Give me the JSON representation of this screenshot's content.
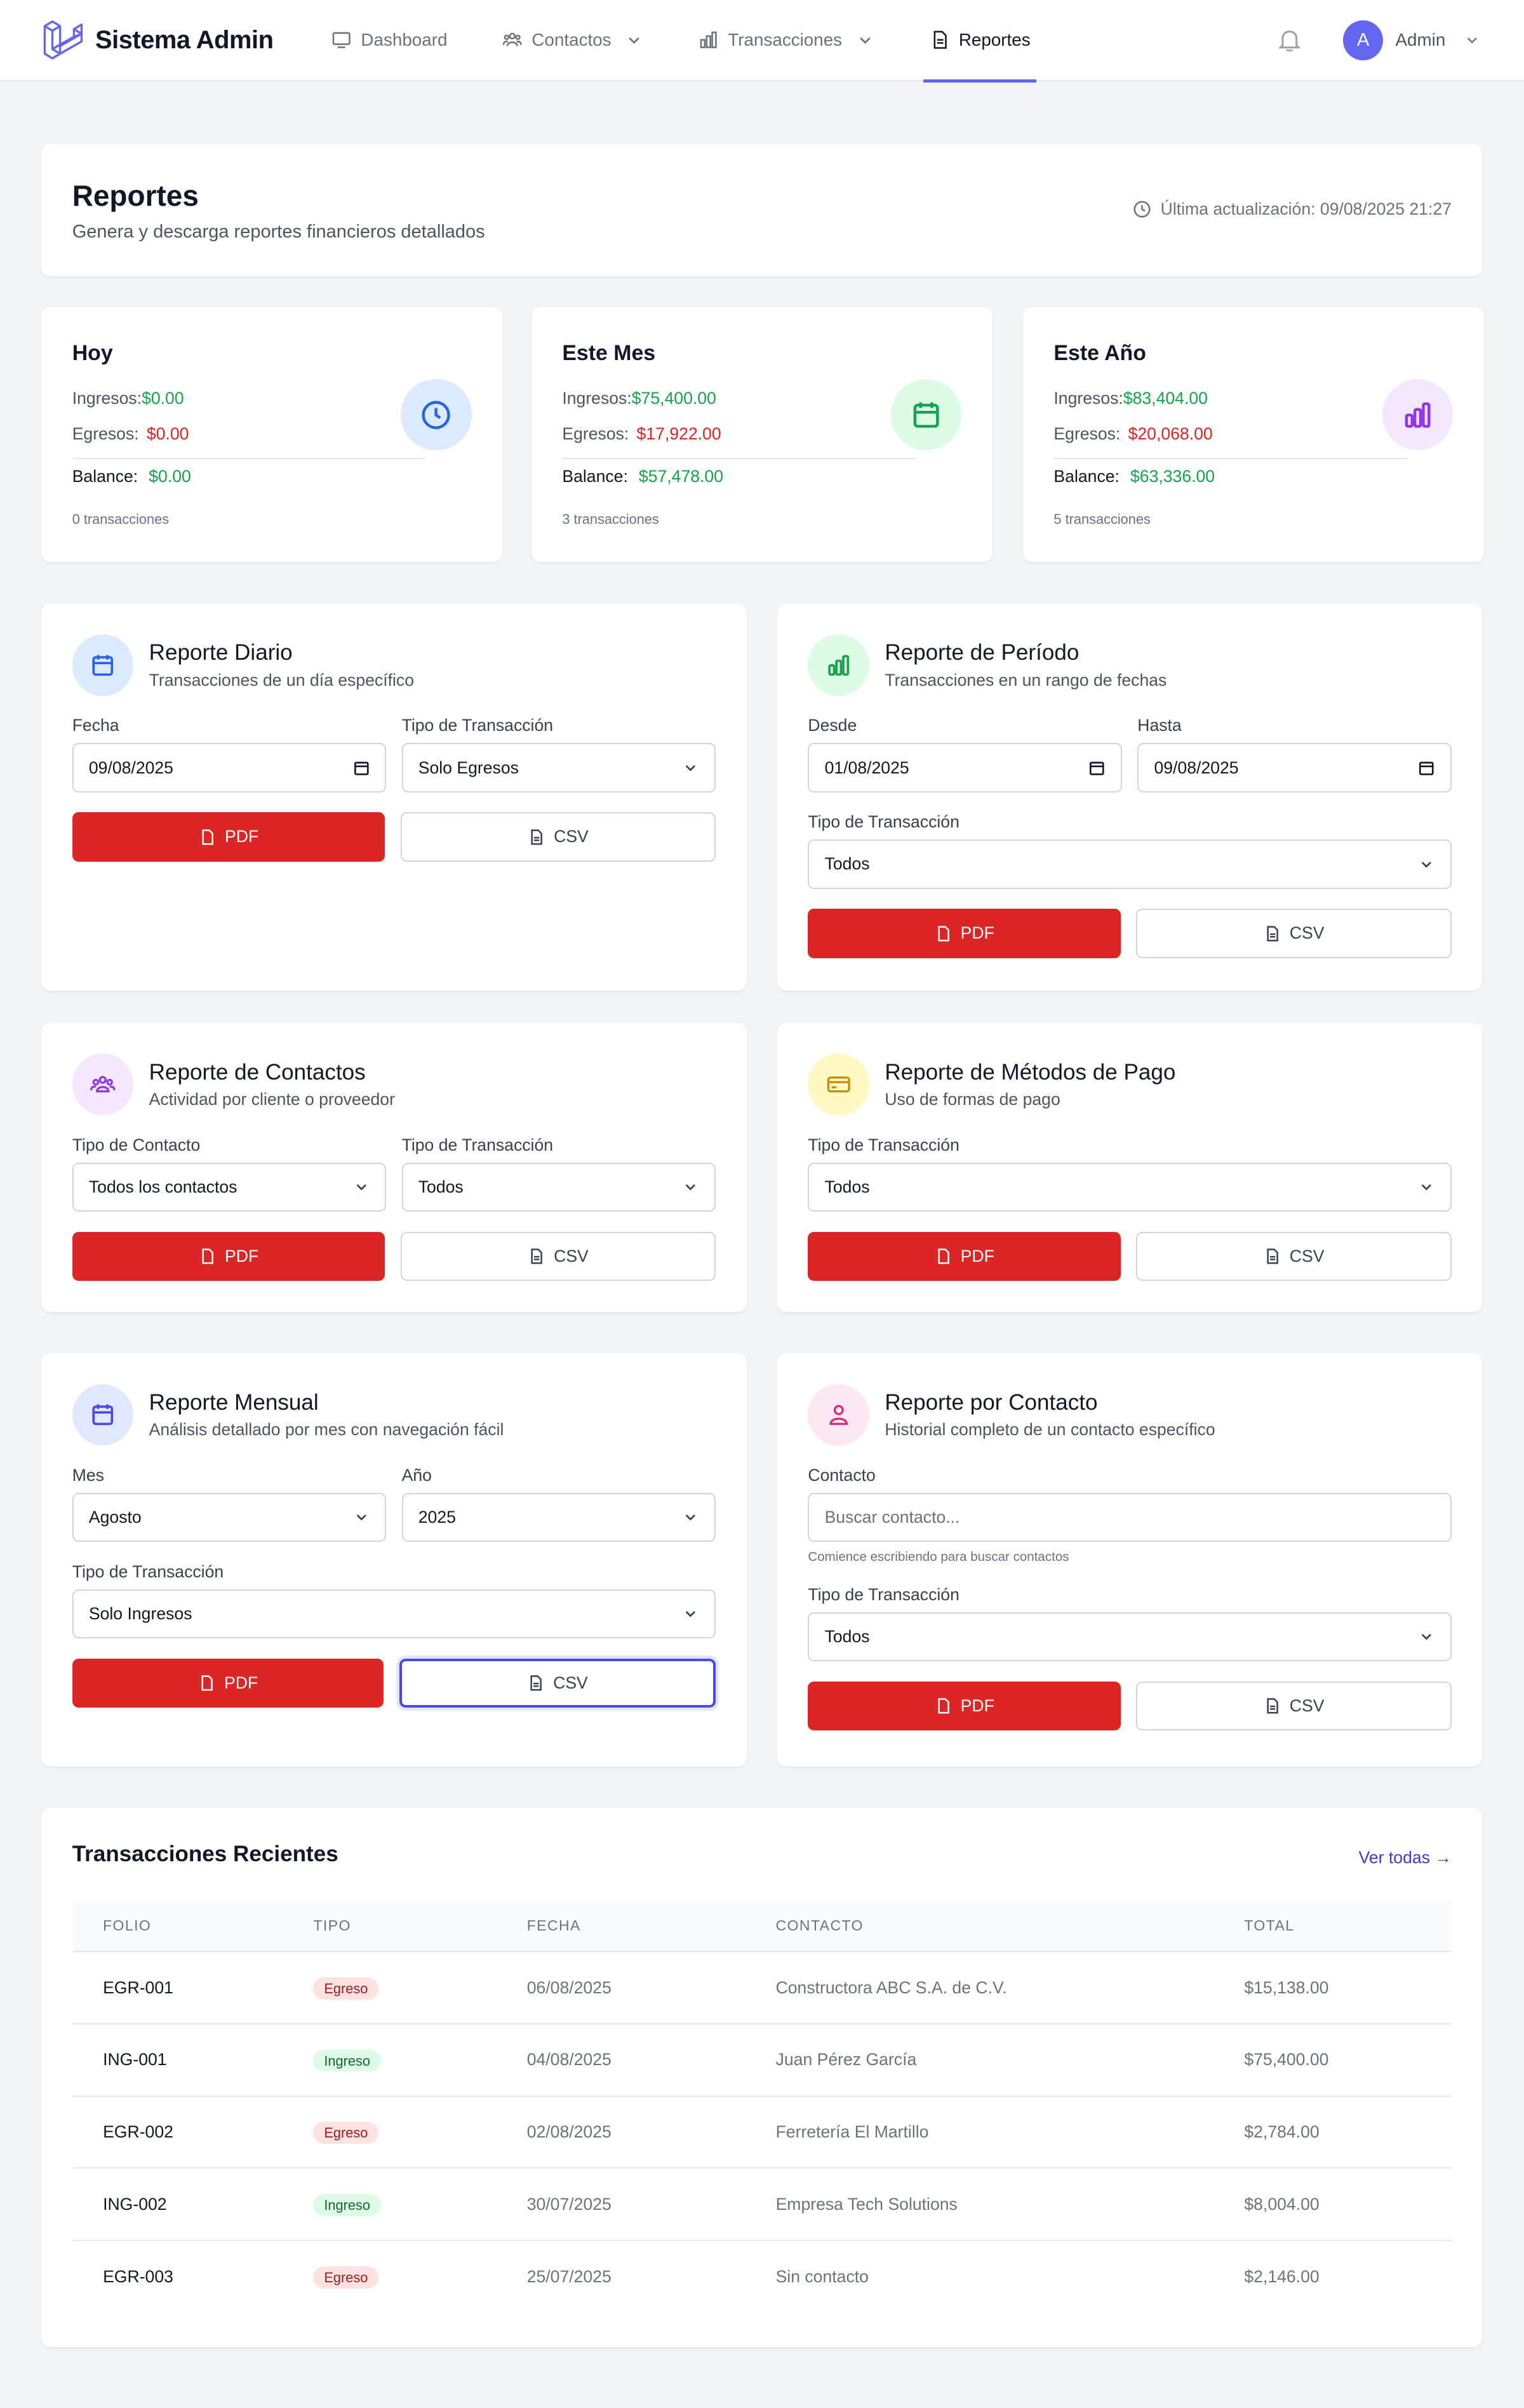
{
  "nav": {
    "brand": "Sistema Admin",
    "items": [
      {
        "label": "Dashboard",
        "icon": "monitor-icon"
      },
      {
        "label": "Contactos",
        "icon": "users-icon"
      },
      {
        "label": "Transacciones",
        "icon": "bar-chart-icon"
      },
      {
        "label": "Reportes",
        "icon": "document-icon"
      }
    ],
    "user": {
      "initial": "A",
      "name": "Admin"
    }
  },
  "header": {
    "title": "Reportes",
    "subtitle": "Genera y descarga reportes financieros detallados",
    "updated": "Última actualización: 09/08/2025 21:27"
  },
  "stats": [
    {
      "title": "Hoy",
      "income_label": "Ingresos:",
      "income": "$0.00",
      "expense_label": "Egresos:",
      "expense": "$0.00",
      "balance_label": "Balance:",
      "balance": "$0.00",
      "count": "0 transacciones"
    },
    {
      "title": "Este Mes",
      "income_label": "Ingresos:",
      "income": "$75,400.00",
      "expense_label": "Egresos:",
      "expense": "$17,922.00",
      "balance_label": "Balance:",
      "balance": "$57,478.00",
      "count": "3 transacciones"
    },
    {
      "title": "Este Año",
      "income_label": "Ingresos:",
      "income": "$83,404.00",
      "expense_label": "Egresos:",
      "expense": "$20,068.00",
      "balance_label": "Balance:",
      "balance": "$63,336.00",
      "count": "5 transacciones"
    }
  ],
  "labels": {
    "fecha": "Fecha",
    "tipo_transaccion": "Tipo de Transacción",
    "desde": "Desde",
    "hasta": "Hasta",
    "tipo_contacto": "Tipo de Contacto",
    "mes": "Mes",
    "anio": "Año",
    "contacto": "Contacto",
    "pdf": "PDF",
    "csv": "CSV"
  },
  "reports": {
    "diario": {
      "title": "Reporte Diario",
      "subtitle": "Transacciones de un día específico",
      "fecha": "09/08/2025",
      "tipo": "Solo Egresos"
    },
    "periodo": {
      "title": "Reporte de Período",
      "subtitle": "Transacciones en un rango de fechas",
      "desde": "01/08/2025",
      "hasta": "09/08/2025",
      "tipo": "Todos"
    },
    "contactos": {
      "title": "Reporte de Contactos",
      "subtitle": "Actividad por cliente o proveedor",
      "tipo_contacto": "Todos los contactos",
      "tipo": "Todos"
    },
    "metodos": {
      "title": "Reporte de Métodos de Pago",
      "subtitle": "Uso de formas de pago",
      "tipo": "Todos"
    },
    "mensual": {
      "title": "Reporte Mensual",
      "subtitle": "Análisis detallado por mes con navegación fácil",
      "mes": "Agosto",
      "anio": "2025",
      "tipo": "Solo Ingresos"
    },
    "por_contacto": {
      "title": "Reporte por Contacto",
      "subtitle": "Historial completo de un contacto específico",
      "placeholder": "Buscar contacto...",
      "help": "Comience escribiendo para buscar contactos",
      "tipo": "Todos"
    }
  },
  "transactions": {
    "title": "Transacciones Recientes",
    "view_all": "Ver todas →",
    "columns": [
      "FOLIO",
      "TIPO",
      "FECHA",
      "CONTACTO",
      "TOTAL"
    ],
    "rows": [
      {
        "folio": "EGR-001",
        "tipo": "Egreso",
        "fecha": "06/08/2025",
        "contacto": "Constructora ABC S.A. de C.V.",
        "total": "$15,138.00"
      },
      {
        "folio": "ING-001",
        "tipo": "Ingreso",
        "fecha": "04/08/2025",
        "contacto": "Juan Pérez García",
        "total": "$75,400.00"
      },
      {
        "folio": "EGR-002",
        "tipo": "Egreso",
        "fecha": "02/08/2025",
        "contacto": "Ferretería El Martillo",
        "total": "$2,784.00"
      },
      {
        "folio": "ING-002",
        "tipo": "Ingreso",
        "fecha": "30/07/2025",
        "contacto": "Empresa Tech Solutions",
        "total": "$8,004.00"
      },
      {
        "folio": "EGR-003",
        "tipo": "Egreso",
        "fecha": "25/07/2025",
        "contacto": "Sin contacto",
        "total": "$2,146.00"
      }
    ]
  },
  "colors": {
    "accent": "#6366f1",
    "danger": "#dc2626",
    "success": "#16a34a"
  }
}
